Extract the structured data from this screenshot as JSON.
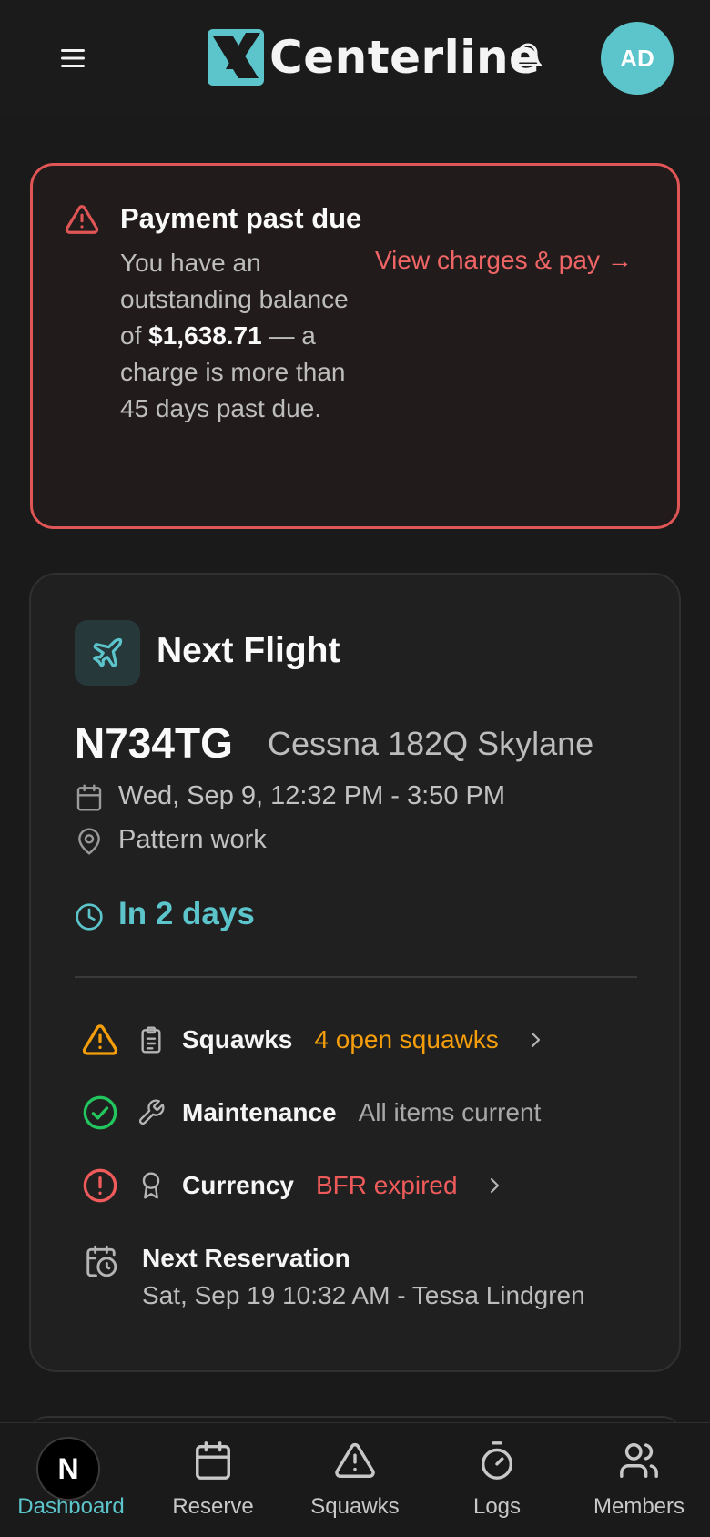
{
  "header": {
    "brand": "Centerline",
    "avatar_initials": "AD"
  },
  "alert": {
    "title": "Payment past due",
    "body_prefix": "You have an outstanding balance of ",
    "amount": "$1,638.71",
    "body_suffix": " — a charge is more than 45 days past due.",
    "link": "View charges & pay →"
  },
  "flight": {
    "card_title": "Next Flight",
    "tail_number": "N734TG",
    "aircraft_model": "Cessna 182Q Skylane",
    "time": "Wed, Sep 9, 12:32 PM - 3:50 PM",
    "location": "Pattern work",
    "countdown": "In 2 days",
    "statuses": [
      {
        "label": "Squawks",
        "value": "4 open squawks",
        "color": "#f59e0b"
      },
      {
        "label": "Maintenance",
        "value": "All items current",
        "color": "#a8a8a8"
      },
      {
        "label": "Currency",
        "value": "BFR expired",
        "color": "#ef5b5b"
      }
    ],
    "next_reservation": {
      "title": "Next Reservation",
      "detail": "Sat, Sep 19 10:32 AM - Tessa Lindgren"
    }
  },
  "nav": {
    "badge": "N",
    "items": [
      {
        "label": "Dashboard"
      },
      {
        "label": "Reserve"
      },
      {
        "label": "Squawks"
      },
      {
        "label": "Logs"
      },
      {
        "label": "Members"
      }
    ]
  },
  "colors": {
    "accent": "#5cc5cb",
    "danger": "#e05555",
    "warning": "#f59e0b",
    "success": "#22c55e"
  }
}
